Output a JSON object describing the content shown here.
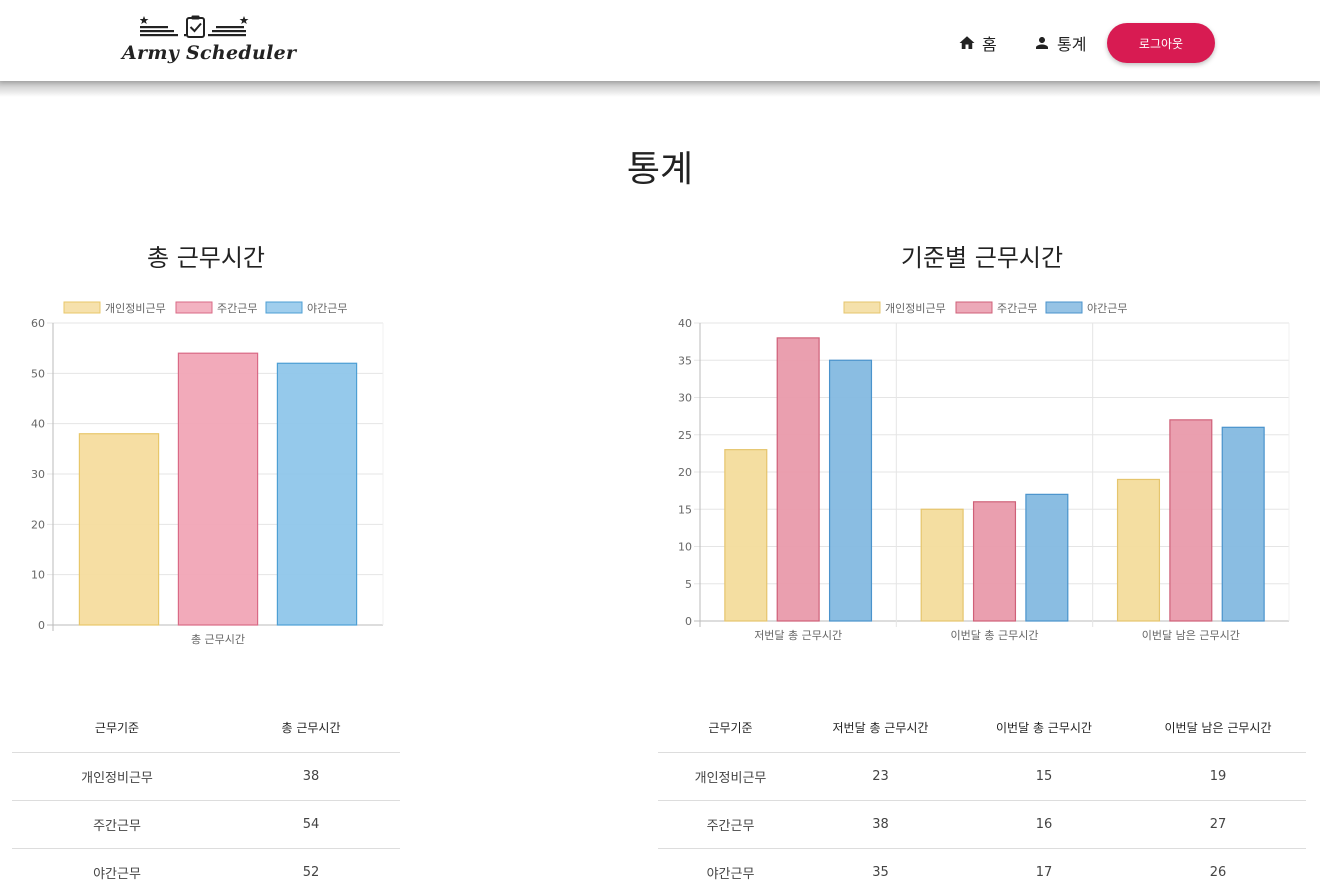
{
  "nav": {
    "logo_text": "Army Scheduler",
    "home_label": "홈",
    "stats_label": "통계",
    "logout_label": "로그아웃",
    "accent": "#d81b52"
  },
  "page_title": "통계",
  "left_section": {
    "title": "총 근무시간"
  },
  "right_section": {
    "title": "기준별 근무시간"
  },
  "chart_data": [
    {
      "type": "bar",
      "categories": [
        "총 근무시간"
      ],
      "series": [
        {
          "name": "개인정비근무",
          "values": [
            38
          ],
          "color": "#f5dc9e",
          "border": "#e8c76a"
        },
        {
          "name": "주간근무",
          "values": [
            54
          ],
          "color": "#f1a5b6",
          "border": "#d96a86"
        },
        {
          "name": "야간근무",
          "values": [
            52
          ],
          "color": "#8fc6ea",
          "border": "#4d9fd4"
        }
      ],
      "ylim": [
        0,
        60
      ],
      "yticks": [
        0,
        10,
        20,
        30,
        40,
        50,
        60
      ],
      "grid": true,
      "legend": "top"
    },
    {
      "type": "bar",
      "categories": [
        "저번달 총 근무시간",
        "이번달 총 근무시간",
        "이번달 남은 근무시간"
      ],
      "series": [
        {
          "name": "개인정비근무",
          "values": [
            23,
            15,
            19
          ],
          "color": "#f3dc9c",
          "border": "#e5c56d"
        },
        {
          "name": "주간근무",
          "values": [
            38,
            16,
            27
          ],
          "color": "#e99aab",
          "border": "#cf6078"
        },
        {
          "name": "야간근무",
          "values": [
            35,
            17,
            26
          ],
          "color": "#84b9e0",
          "border": "#4a93cc"
        }
      ],
      "ylim": [
        0,
        40
      ],
      "yticks": [
        0,
        5,
        10,
        15,
        20,
        25,
        30,
        35,
        40
      ],
      "grid": true,
      "legend": "top"
    }
  ],
  "left_table": {
    "headers": [
      "근무기준",
      "총 근무시간"
    ],
    "rows": [
      [
        "개인정비근무",
        "38"
      ],
      [
        "주간근무",
        "54"
      ],
      [
        "야간근무",
        "52"
      ]
    ]
  },
  "right_table": {
    "headers": [
      "근무기준",
      "저번달 총 근무시간",
      "이번달 총 근무시간",
      "이번달 남은 근무시간"
    ],
    "rows": [
      [
        "개인정비근무",
        "23",
        "15",
        "19"
      ],
      [
        "주간근무",
        "38",
        "16",
        "27"
      ],
      [
        "야간근무",
        "35",
        "17",
        "26"
      ]
    ]
  }
}
